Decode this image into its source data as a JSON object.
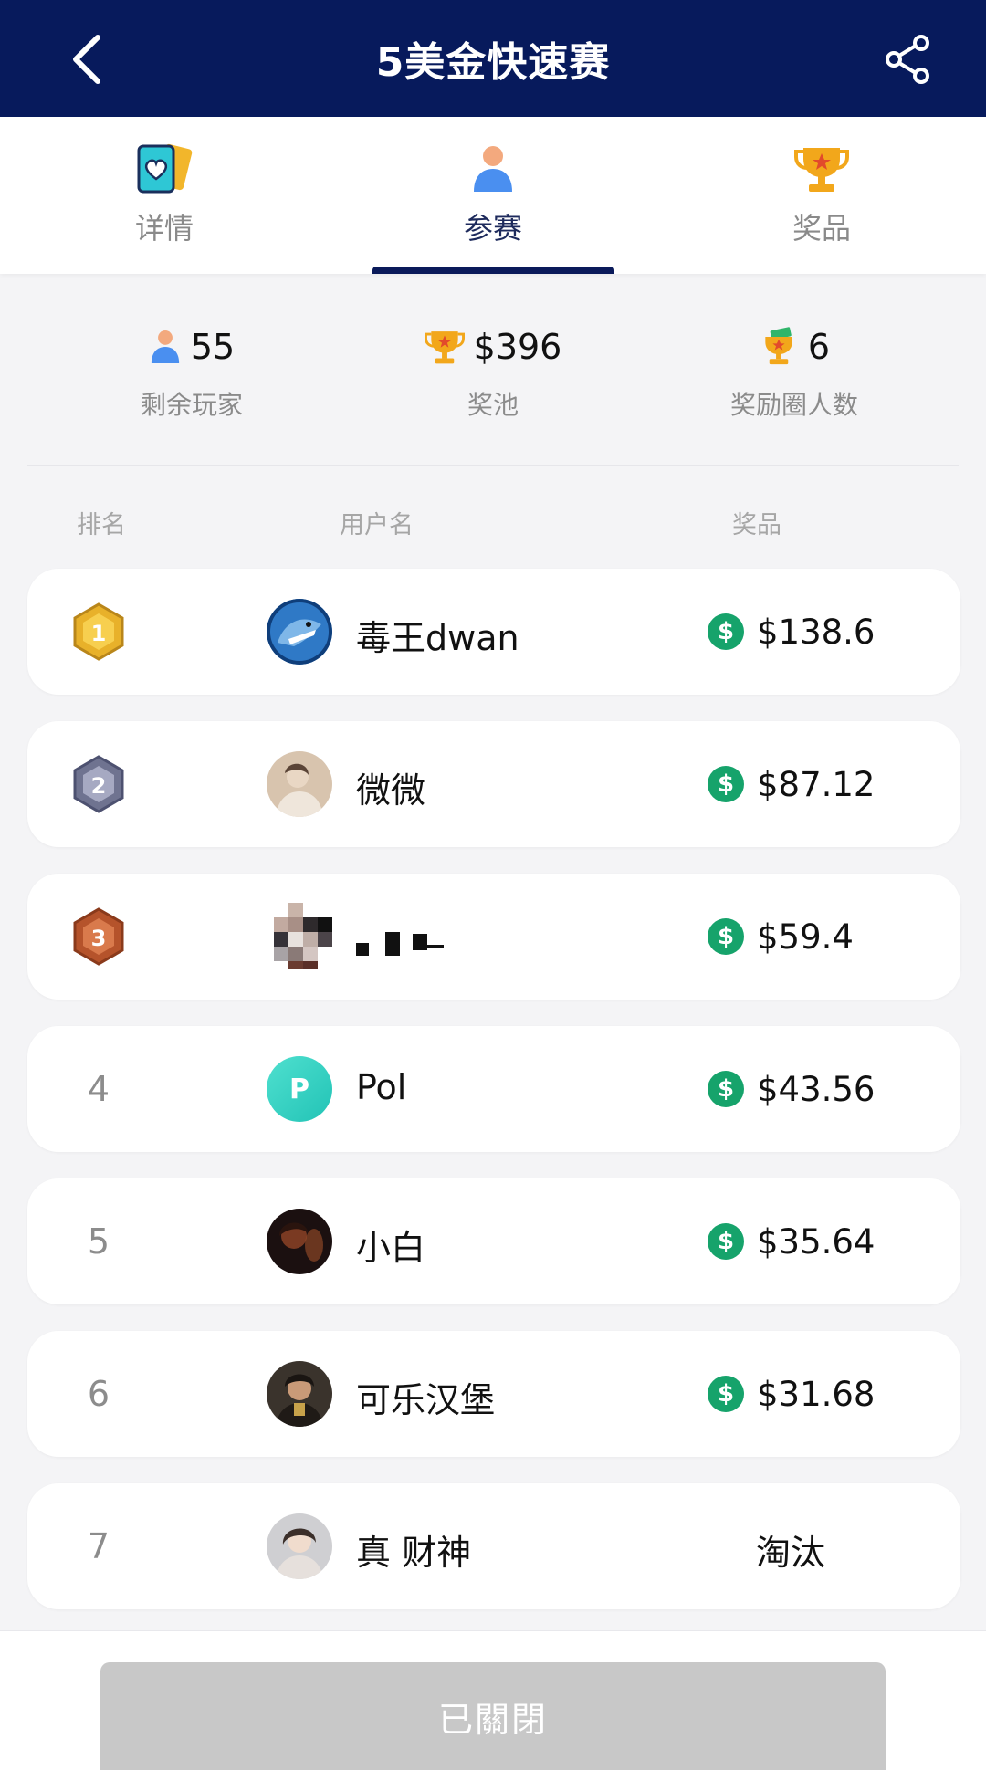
{
  "header": {
    "title": "5美金快速赛",
    "back_icon": "chevron-left-icon",
    "share_icon": "share-icon"
  },
  "tabs": [
    {
      "label": "详情",
      "icon": "cards-icon",
      "active": false
    },
    {
      "label": "参赛",
      "icon": "user-icon",
      "active": true
    },
    {
      "label": "奖品",
      "icon": "trophy-icon",
      "active": false
    }
  ],
  "stats": {
    "remaining_players": {
      "value": "55",
      "label": "剩余玩家"
    },
    "prize_pool": {
      "value": "$396",
      "label": "奖池"
    },
    "paid_places": {
      "value": "6",
      "label": "奖励圈人数"
    }
  },
  "columns": {
    "rank": "排名",
    "username": "用户名",
    "prize": "奖品"
  },
  "players": [
    {
      "rank": "1",
      "username": "毒王dwan",
      "prize": "$138.6",
      "medal": "gold"
    },
    {
      "rank": "2",
      "username": "微微",
      "prize": "$87.12",
      "medal": "silver"
    },
    {
      "rank": "3",
      "username": "",
      "prize": "$59.4",
      "medal": "bronze"
    },
    {
      "rank": "4",
      "username": "Pol",
      "prize": "$43.56",
      "avatar_letter": "P"
    },
    {
      "rank": "5",
      "username": "小白",
      "prize": "$35.64"
    },
    {
      "rank": "6",
      "username": "可乐汉堡",
      "prize": "$31.68"
    },
    {
      "rank": "7",
      "username": "真 财神",
      "status": "淘汰"
    }
  ],
  "footer": {
    "button_label": "已關閉"
  },
  "colors": {
    "header_bg": "#071a5c",
    "prize_icon": "#16a36b",
    "gold": "#e8b12a",
    "silver": "#6f7390",
    "bronze": "#b5532b",
    "disabled_button": "#c8c8c8"
  }
}
